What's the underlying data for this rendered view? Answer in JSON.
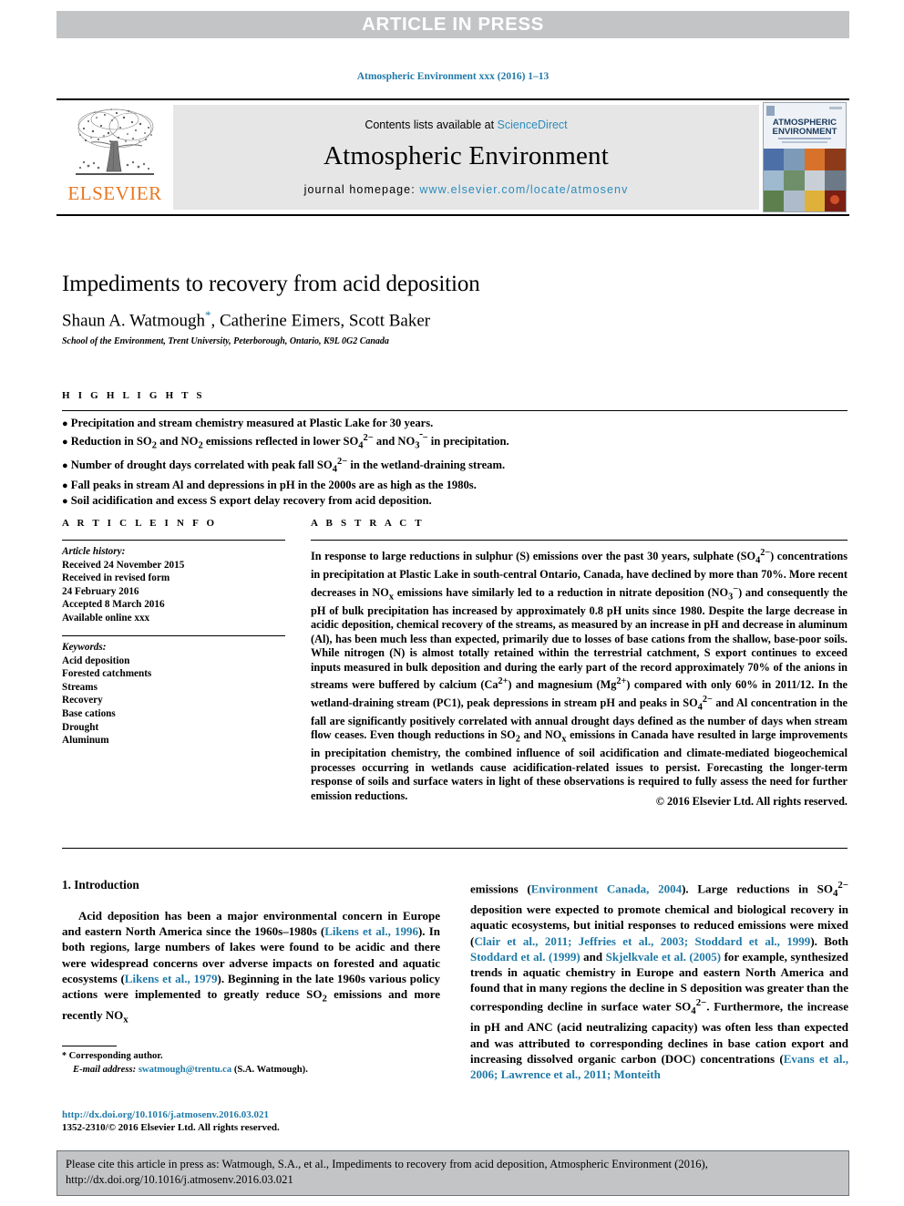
{
  "press_banner": "ARTICLE IN PRESS",
  "journal_line": "Atmospheric Environment xxx (2016) 1–13",
  "masthead": {
    "contents_prefix": "Contents lists available at ",
    "sciencedirect": "ScienceDirect",
    "journal_title": "Atmospheric Environment",
    "homepage_prefix": "journal homepage: ",
    "homepage_url": "www.elsevier.com/locate/atmosenv",
    "publisher": "ELSEVIER",
    "cover_title_line1": "ATMOSPHERIC",
    "cover_title_line2": "ENVIRONMENT"
  },
  "article": {
    "title": "Impediments to recovery from acid deposition",
    "authors": "Shaun A. Watmough, Catherine Eimers, Scott Baker",
    "corresponding_marker": "*",
    "affiliation": "School of the Environment, Trent University, Peterborough, Ontario, K9L 0G2 Canada"
  },
  "highlights": {
    "heading": "H I G H L I G H T S",
    "items": [
      "Precipitation and stream chemistry measured at Plastic Lake for 30 years.",
      "Reduction in SO2 and NO2 emissions reflected in lower SO42− and NO3− in precipitation.",
      "Number of drought days correlated with peak fall SO42− in the wetland-draining stream.",
      "Fall peaks in stream Al and depressions in pH in the 2000s are as high as the 1980s.",
      "Soil acidification and excess S export delay recovery from acid deposition."
    ]
  },
  "article_info": {
    "heading": "A R T I C L E  I N F O",
    "history_label": "Article history:",
    "history": [
      "Received 24 November 2015",
      "Received in revised form",
      "24 February 2016",
      "Accepted 8 March 2016",
      "Available online xxx"
    ],
    "keywords_label": "Keywords:",
    "keywords": [
      "Acid deposition",
      "Forested catchments",
      "Streams",
      "Recovery",
      "Base cations",
      "Drought",
      "Aluminum"
    ]
  },
  "abstract": {
    "heading": "A B S T R A C T",
    "text": "In response to large reductions in sulphur (S) emissions over the past 30 years, sulphate (SO42−) concentrations in precipitation at Plastic Lake in south-central Ontario, Canada, have declined by more than 70%. More recent decreases in NOx emissions have similarly led to a reduction in nitrate deposition (NO3−) and consequently the pH of bulk precipitation has increased by approximately 0.8 pH units since 1980. Despite the large decrease in acidic deposition, chemical recovery of the streams, as measured by an increase in pH and decrease in aluminum (Al), has been much less than expected, primarily due to losses of base cations from the shallow, base-poor soils. While nitrogen (N) is almost totally retained within the terrestrial catchment, S export continues to exceed inputs measured in bulk deposition and during the early part of the record approximately 70% of the anions in streams were buffered by calcium (Ca2+) and magnesium (Mg2+) compared with only 60% in 2011/12. In the wetland-draining stream (PC1), peak depressions in stream pH and peaks in SO42− and Al concentration in the fall are significantly positively correlated with annual drought days defined as the number of days when stream flow ceases. Even though reductions in SO2 and NOx emissions in Canada have resulted in large improvements in precipitation chemistry, the combined influence of soil acidification and climate-mediated biogeochemical processes occurring in wetlands cause acidification-related issues to persist. Forecasting the longer-term response of soils and surface waters in light of these observations is required to fully assess the need for further emission reductions.",
    "copyright": "© 2016 Elsevier Ltd. All rights reserved."
  },
  "introduction": {
    "heading": "1. Introduction",
    "left_paragraph": "Acid deposition has been a major environmental concern in Europe and eastern North America since the 1960s–1980s (Likens et al., 1996). In both regions, large numbers of lakes were found to be acidic and there were widespread concerns over adverse impacts on forested and aquatic ecosystems (Likens et al., 1979). Beginning in the late 1960s various policy actions were implemented to greatly reduce SO2 emissions and more recently NOx",
    "right_paragraph": "emissions (Environment Canada, 2004). Large reductions in SO42− deposition were expected to promote chemical and biological recovery in aquatic ecosystems, but initial responses to reduced emissions were mixed (Clair et al., 2011; Jeffries et al., 2003; Stoddard et al., 1999). Both Stoddard et al. (1999) and Skjelkvale et al. (2005) for example, synthesized trends in aquatic chemistry in Europe and eastern North America and found that in many regions the decline in S deposition was greater than the corresponding decline in surface water SO42−. Furthermore, the increase in pH and ANC (acid neutralizing capacity) was often less than expected and was attributed to corresponding declines in base cation export and increasing dissolved organic carbon (DOC) concentrations (Evans et al., 2006; Lawrence et al., 2011; Monteith"
  },
  "footnote": {
    "corresponding": "Corresponding author.",
    "email_label": "E-mail address:",
    "email": "swatmough@trentu.ca",
    "email_suffix": "(S.A. Watmough)."
  },
  "doi_block": {
    "doi_url": "http://dx.doi.org/10.1016/j.atmosenv.2016.03.021",
    "issn_line": "1352-2310/© 2016 Elsevier Ltd. All rights reserved."
  },
  "cite_box": {
    "line1": "Please cite this article in press as: Watmough, S.A., et al., Impediments to recovery from acid deposition, Atmospheric Environment (2016),",
    "line2": "http://dx.doi.org/10.1016/j.atmosenv.2016.03.021"
  },
  "colors": {
    "link": "#1f7aa8",
    "banner_gray": "#c3c4c6",
    "elsevier_orange": "#e87722",
    "masthead_gray": "#e6e6e6"
  }
}
